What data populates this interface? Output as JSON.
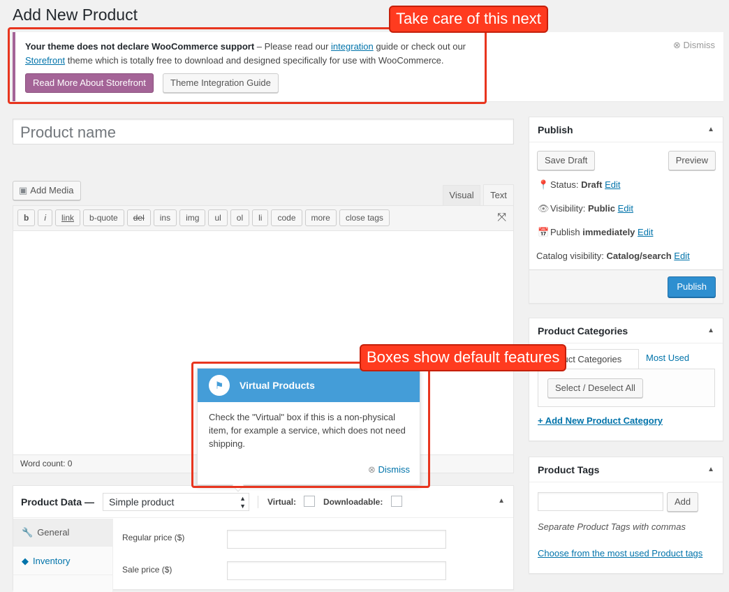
{
  "page": {
    "title": "Add New Product"
  },
  "notice": {
    "bold": "Your theme does not declare WooCommerce support",
    "text1": " – Please read our ",
    "link1": "integration",
    "text2": " guide or check out our ",
    "link2": "Storefront",
    "text3": " theme which is totally free to download and designed specifically for use with WooCommerce.",
    "primary_button": "Read More About Storefront",
    "secondary_button": "Theme Integration Guide",
    "dismiss": "Dismiss"
  },
  "editor": {
    "title_placeholder": "Product name",
    "add_media": "Add Media",
    "tab_visual": "Visual",
    "tab_text": "Text",
    "quicktags": [
      "b",
      "i",
      "link",
      "b-quote",
      "del",
      "ins",
      "img",
      "ul",
      "ol",
      "li",
      "code",
      "more",
      "close tags"
    ],
    "word_count": "Word count: 0"
  },
  "pointer": {
    "title": "Virtual Products",
    "body": "Check the \"Virtual\" box if this is a non-physical item, for example a service, which does not need shipping.",
    "dismiss": "Dismiss"
  },
  "product_data": {
    "label": "Product Data —",
    "type_selected": "Simple product",
    "virtual_label": "Virtual:",
    "downloadable_label": "Downloadable:",
    "tabs": [
      "General",
      "Inventory"
    ],
    "regular_price_label": "Regular price ($)",
    "sale_price_label": "Sale price ($)"
  },
  "publish": {
    "title": "Publish",
    "save_draft": "Save Draft",
    "preview": "Preview",
    "status_label": "Status:",
    "status_value": "Draft",
    "visibility_label": "Visibility:",
    "visibility_value": "Public",
    "publish_label": "Publish",
    "publish_value": "immediately",
    "catalog_label": "Catalog visibility:",
    "catalog_value": "Catalog/search",
    "edit": "Edit",
    "publish_button": "Publish"
  },
  "categories": {
    "title": "Product Categories",
    "tab_all": "Product Categories",
    "tab_most_used": "Most Used",
    "select_all": "Select / Deselect All",
    "add_new": "+ Add New Product Category"
  },
  "tags": {
    "title": "Product Tags",
    "add": "Add",
    "hint": "Separate Product Tags with commas",
    "choose": "Choose from the most used Product tags"
  },
  "annotations": {
    "top": "Take care of this next",
    "middle": "Boxes show default features"
  },
  "colors": {
    "accent_purple": "#a46497",
    "wp_blue": "#0073aa",
    "publish_blue": "#2e8fd0",
    "pointer_blue": "#449dd8",
    "annotation_red": "#ff3b1f"
  }
}
